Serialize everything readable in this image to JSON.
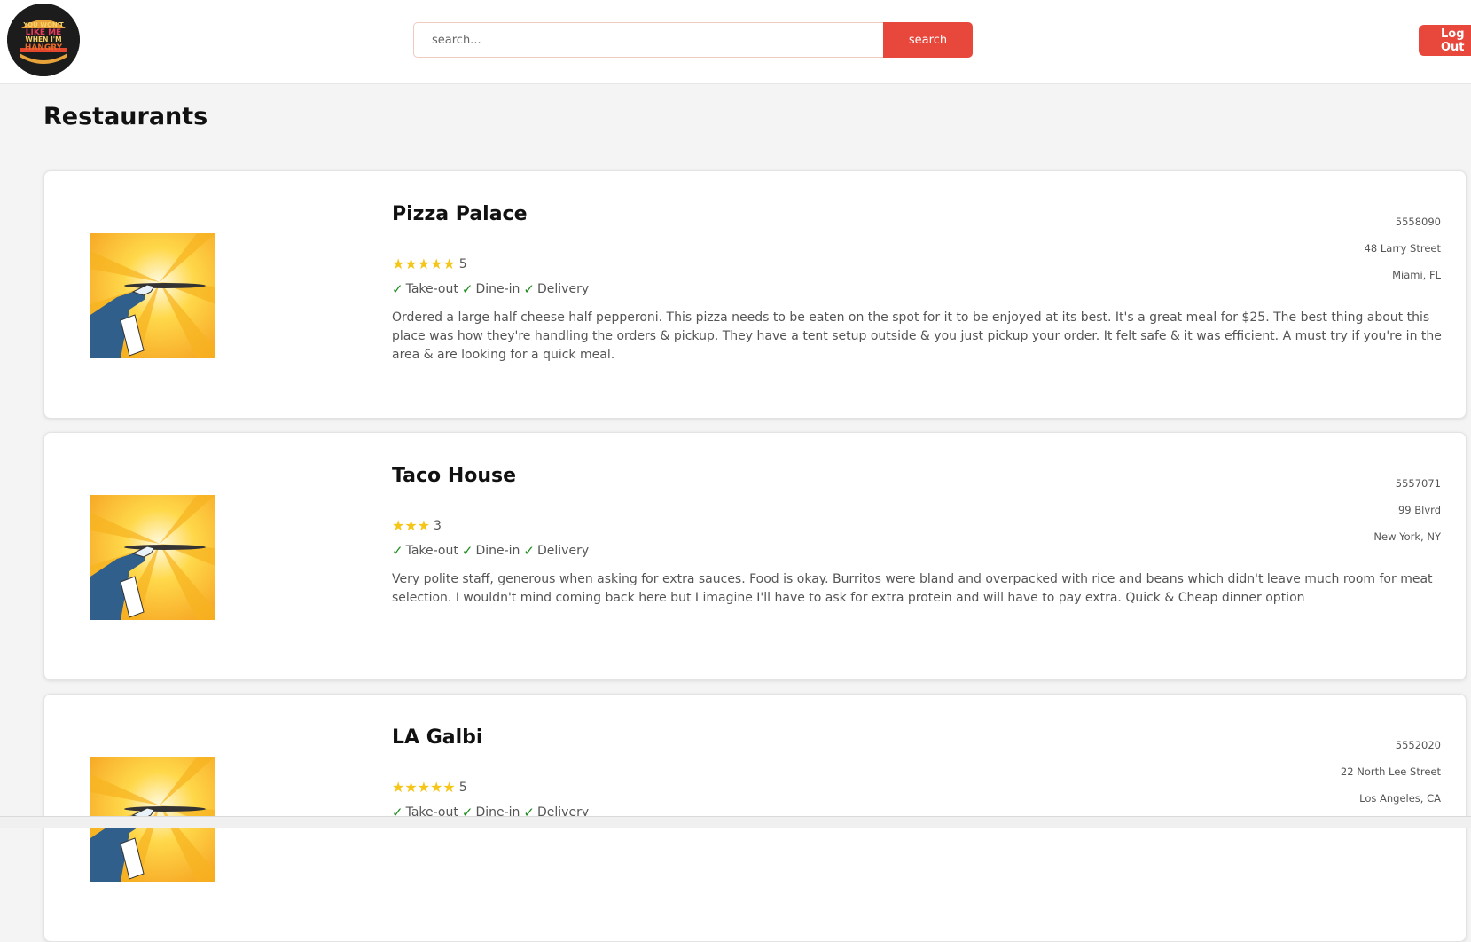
{
  "header": {
    "logo_text": "YOU WON'T LIKE ME WHEN I'M HANGRY",
    "search_placeholder": "search...",
    "search_button": "search",
    "login_button": "Log Out"
  },
  "page_title": "Restaurants",
  "restaurants": [
    {
      "name": "Pizza Palace",
      "rating": 5,
      "stars": "★★★★★",
      "options": [
        "Take-out",
        "Dine-in",
        "Delivery"
      ],
      "review": "Ordered a large half cheese half pepperoni. This pizza needs to be eaten on the spot for it to be enjoyed at its best. It's a great meal for $25. The best thing about this place was how they're handling the orders & pickup. They have a tent setup outside & you just pickup your order. It felt safe & it was efficient. A must try if you're in the area & are looking for a quick meal.",
      "phone": "5558090",
      "street": "48 Larry Street",
      "city": "Miami, FL"
    },
    {
      "name": "Taco House",
      "rating": 3,
      "stars": "★★★",
      "options": [
        "Take-out",
        "Dine-in",
        "Delivery"
      ],
      "review": "Very polite staff, generous when asking for extra sauces. Food is okay. Burritos were bland and overpacked with rice and beans which didn't leave much room for meat selection. I wouldn't mind coming back here but I imagine I'll have to ask for extra protein and will have to pay extra. Quick & Cheap dinner option",
      "phone": "5557071",
      "street": "99 Blvrd",
      "city": "New York, NY"
    },
    {
      "name": "LA Galbi",
      "rating": 5,
      "stars": "★★★★★",
      "options": [
        "Take-out",
        "Dine-in",
        "Delivery"
      ],
      "review": "",
      "phone": "5552020",
      "street": "22 North Lee Street",
      "city": "Los Angeles, CA"
    }
  ],
  "colors": {
    "accent": "#e8473b",
    "star": "#f5c518",
    "check": "#1c8a1c"
  }
}
